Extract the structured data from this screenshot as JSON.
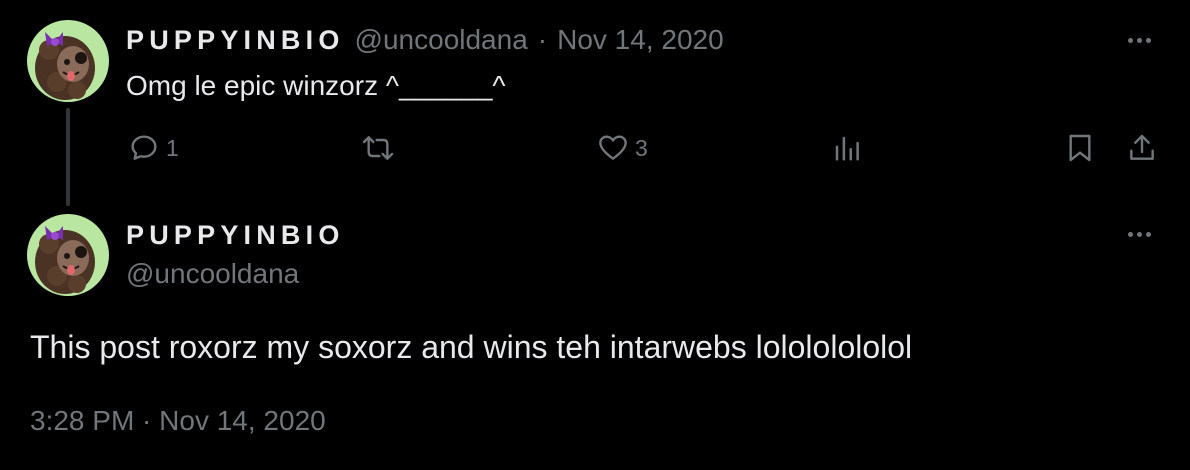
{
  "reply": {
    "author": {
      "display_name": "PUPPYINBIO",
      "handle": "@uncooldana",
      "avatar_icon": "dog-avatar-icon"
    },
    "separator": "·",
    "date": "Nov 14, 2020",
    "text": "Omg le epic winzorz ^______^",
    "actions": {
      "reply_count": "1",
      "retweet_count": "",
      "like_count": "3",
      "views_count": ""
    }
  },
  "main_post": {
    "author": {
      "display_name": "PUPPYINBIO",
      "handle": "@uncooldana",
      "avatar_icon": "dog-avatar-icon"
    },
    "text": "This post roxorz my soxorz and wins teh intarwebs lolololololol",
    "timestamp": "3:28 PM · Nov 14, 2020"
  },
  "colors": {
    "background": "#000000",
    "text_primary": "#e7e9ea",
    "text_secondary": "#71767b",
    "avatar_bg": "#b9e6a0"
  }
}
